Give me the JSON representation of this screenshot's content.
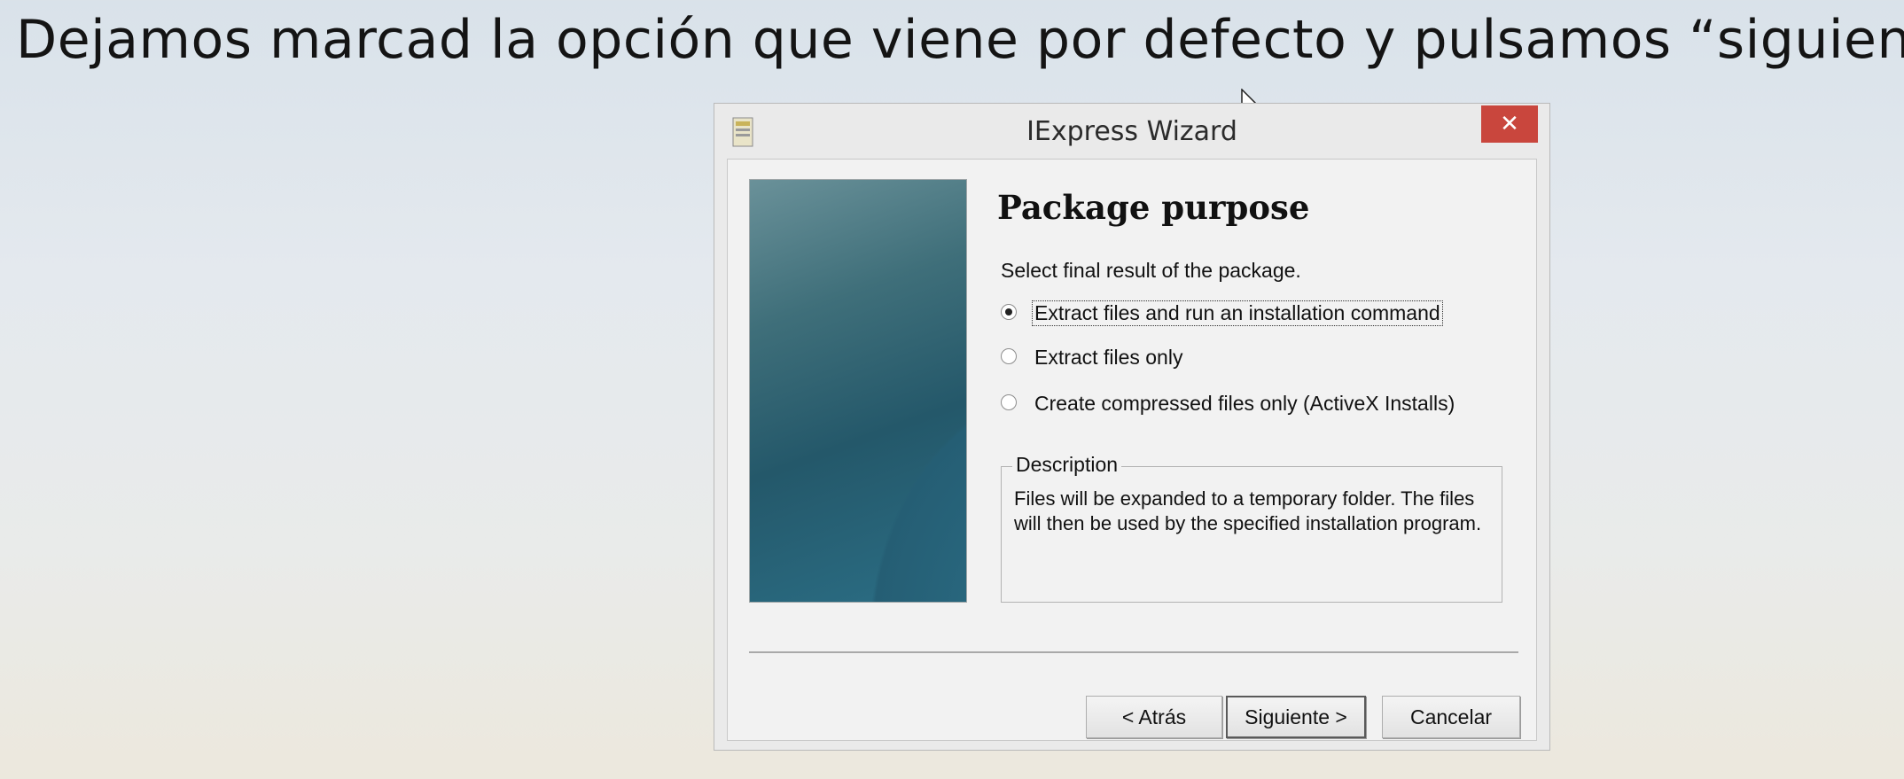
{
  "caption": "Dejamos marcad la opción que viene por defecto y pulsamos “siguiente”",
  "window": {
    "title": "IExpress Wizard",
    "close_label": "✕"
  },
  "page": {
    "heading": "Package purpose",
    "instruction": "Select final result of the package.",
    "options": [
      {
        "label": "Extract files and run an installation command",
        "selected": true
      },
      {
        "label": "Extract files only",
        "selected": false
      },
      {
        "label": "Create compressed files only (ActiveX Installs)",
        "selected": false
      }
    ],
    "description": {
      "legend": "Description",
      "text": "Files will be expanded to a temporary folder. The files will then be used by the specified installation program."
    }
  },
  "buttons": {
    "back": "< Atrás",
    "next": "Siguiente >",
    "cancel": "Cancelar"
  },
  "colors": {
    "close_button": "#c9463d",
    "banner": "#24586a"
  }
}
